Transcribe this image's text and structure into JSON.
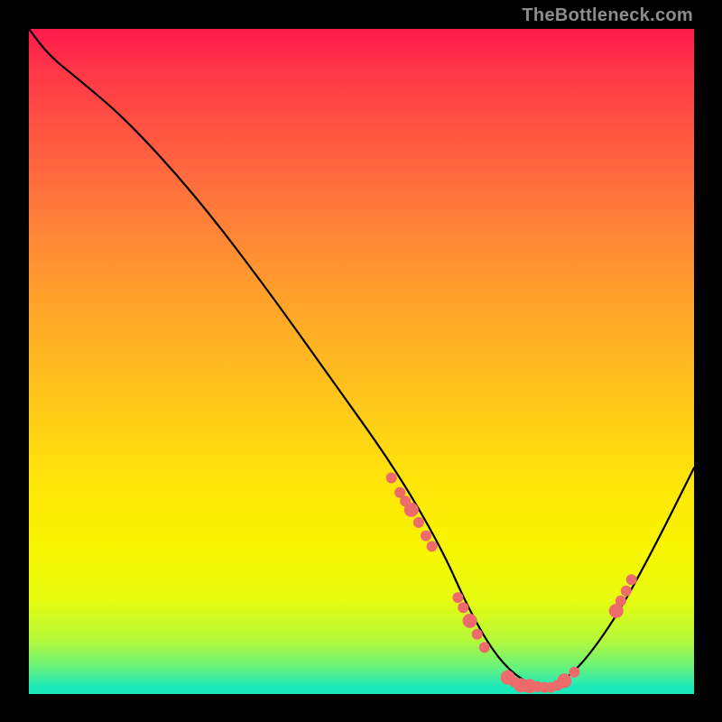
{
  "watermark": "TheBottleneck.com",
  "colors": {
    "background": "#000000",
    "dot": "#ed6b6b",
    "curve": "#000000"
  },
  "chart_data": {
    "type": "line",
    "title": "",
    "xlabel": "",
    "ylabel": "",
    "xlim": [
      0,
      100
    ],
    "ylim": [
      0,
      100
    ],
    "series": [
      {
        "name": "bottleneck-curve",
        "x": [
          0,
          3,
          8,
          15,
          25,
          35,
          45,
          55,
          62,
          66,
          70,
          74,
          78,
          82,
          88,
          94,
          100
        ],
        "y": [
          100,
          96,
          92,
          86,
          75,
          62,
          48,
          34,
          22,
          13,
          6,
          2,
          1,
          3,
          11,
          22,
          34
        ]
      }
    ],
    "markers": {
      "name": "highlight-points",
      "points": [
        {
          "x": 54.5,
          "y": 32.5
        },
        {
          "x": 55.8,
          "y": 30.3
        },
        {
          "x": 56.6,
          "y": 29.0
        },
        {
          "x": 57.5,
          "y": 27.7,
          "r": 8
        },
        {
          "x": 58.6,
          "y": 25.8
        },
        {
          "x": 59.7,
          "y": 23.8
        },
        {
          "x": 60.6,
          "y": 22.2
        },
        {
          "x": 64.5,
          "y": 14.5
        },
        {
          "x": 65.3,
          "y": 13.0
        },
        {
          "x": 66.3,
          "y": 11.0,
          "r": 8
        },
        {
          "x": 67.4,
          "y": 9.0
        },
        {
          "x": 68.5,
          "y": 7.0
        },
        {
          "x": 72.0,
          "y": 2.5,
          "r": 8
        },
        {
          "x": 73.0,
          "y": 1.8
        },
        {
          "x": 74.0,
          "y": 1.3,
          "r": 8
        },
        {
          "x": 75.3,
          "y": 1.2,
          "r": 8
        },
        {
          "x": 76.5,
          "y": 1.1
        },
        {
          "x": 77.5,
          "y": 1.0
        },
        {
          "x": 78.5,
          "y": 1.0
        },
        {
          "x": 79.5,
          "y": 1.3
        },
        {
          "x": 80.5,
          "y": 2.0,
          "r": 8
        },
        {
          "x": 82.0,
          "y": 3.3
        },
        {
          "x": 88.3,
          "y": 12.5,
          "r": 8
        },
        {
          "x": 89.0,
          "y": 14.0
        },
        {
          "x": 89.8,
          "y": 15.5
        },
        {
          "x": 90.6,
          "y": 17.2
        }
      ]
    }
  }
}
